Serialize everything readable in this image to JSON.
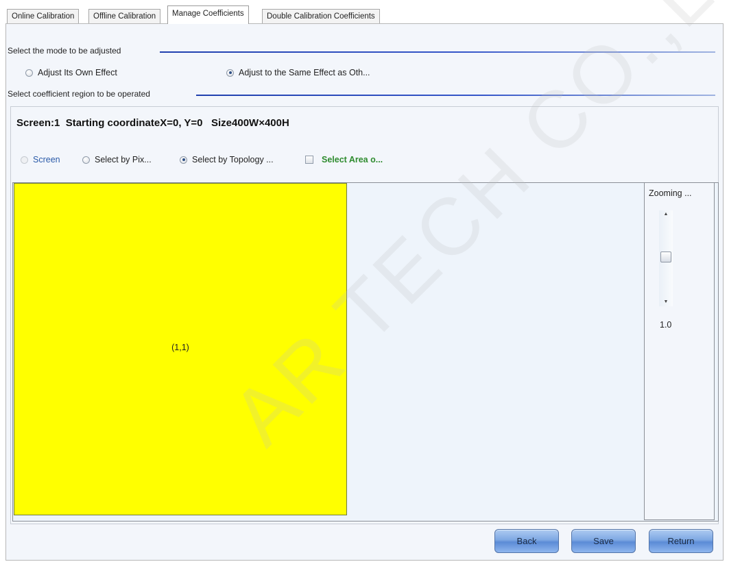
{
  "tabs": [
    {
      "label": "Online Calibration"
    },
    {
      "label": "Offline Calibration"
    },
    {
      "label": "Manage Coefficients"
    },
    {
      "label": "Double Calibration Coefficients"
    }
  ],
  "mode_section": {
    "title": "Select the mode to be adjusted",
    "options": [
      {
        "label": "Adjust Its Own Effect",
        "selected": false
      },
      {
        "label": "Adjust to the Same Effect as Oth...",
        "selected": true
      }
    ]
  },
  "region_section": {
    "title": "Select coefficient region to be operated",
    "screen_info": "Screen:1  Starting coordinateX=0, Y=0   Size400W×400H",
    "options": [
      {
        "label": "Screen",
        "selected": false,
        "disabled": true
      },
      {
        "label": "Select by Pix...",
        "selected": false
      },
      {
        "label": "Select by Topology ...",
        "selected": true
      }
    ],
    "area_checkbox": {
      "label": "Select Area o...",
      "checked": false,
      "color": "#2e8b2e"
    },
    "cell_label": "(1,1)",
    "cell_color": "#ffff00",
    "zoom": {
      "label": "Zooming ...",
      "value": "1.0",
      "slider_position": 0.35
    }
  },
  "buttons": {
    "back": "Back",
    "save": "Save",
    "return": "Return"
  },
  "watermark": "AR TECH CO.,LTD.",
  "colors": {
    "section_line": "#1f3fae",
    "screen_option_text": "#2a5aa8"
  }
}
